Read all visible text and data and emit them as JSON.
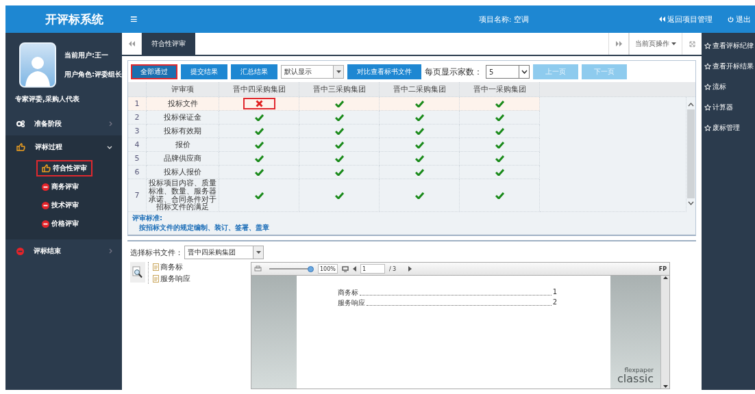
{
  "header": {
    "logo_text": "开评标系统",
    "menu_glyph": "≡",
    "project": "项目名称: 空调",
    "back_link": "返回项目管理",
    "logout": "退出"
  },
  "user": {
    "current": "当前用户:王一",
    "role": "用户角色:评委组长",
    "group": "专家评委,采购人代表"
  },
  "nav": [
    {
      "label": "准备阶段",
      "kind": "gear",
      "expanded": false
    },
    {
      "label": "评标过程",
      "kind": "hand",
      "expanded": true,
      "children": [
        {
          "label": "符合性评审",
          "selected": true
        },
        {
          "label": "商务评审",
          "selected": false
        },
        {
          "label": "技术评审",
          "selected": false
        },
        {
          "label": "价格评审",
          "selected": false
        }
      ]
    },
    {
      "label": "评标结束",
      "kind": "stop",
      "expanded": false
    }
  ],
  "tabs": [
    {
      "label": "符合性评审",
      "selected": true
    }
  ],
  "page_ops": "当前页操作",
  "toolbar": {
    "actions": [
      {
        "label": "全部通过",
        "marked": true
      },
      {
        "label": "提交结果",
        "marked": false
      },
      {
        "label": "汇总结果",
        "marked": false
      }
    ],
    "display_select": "默认显示",
    "compare_button": "对比查看标书文件",
    "per_page_label": "每页显示家数：",
    "per_page": "5",
    "pager": [
      {
        "label": "上一页",
        "disabled": true
      },
      {
        "label": "下一页",
        "disabled": true
      }
    ]
  },
  "table": {
    "columns": [
      "评审项",
      "晋中四采购集团",
      "晋中三采购集团",
      "晋中二采购集团",
      "晋中一采购集团"
    ],
    "rows": [
      {
        "index": "1",
        "item": "投标文件",
        "selected": true,
        "results": [
          {
            "pass": false,
            "marked": true
          },
          {
            "pass": true,
            "marked": false
          },
          {
            "pass": true,
            "marked": false
          },
          {
            "pass": true,
            "marked": false
          }
        ]
      },
      {
        "index": "2",
        "item": "投标保证金",
        "selected": false,
        "results": [
          {
            "pass": true,
            "marked": false
          },
          {
            "pass": true,
            "marked": false
          },
          {
            "pass": true,
            "marked": false
          },
          {
            "pass": true,
            "marked": false
          }
        ]
      },
      {
        "index": "3",
        "item": "投标有效期",
        "selected": false,
        "results": [
          {
            "pass": true,
            "marked": false
          },
          {
            "pass": true,
            "marked": false
          },
          {
            "pass": true,
            "marked": false
          },
          {
            "pass": true,
            "marked": false
          }
        ]
      },
      {
        "index": "4",
        "item": "报价",
        "selected": false,
        "results": [
          {
            "pass": true,
            "marked": false
          },
          {
            "pass": true,
            "marked": false
          },
          {
            "pass": true,
            "marked": false
          },
          {
            "pass": true,
            "marked": false
          }
        ]
      },
      {
        "index": "5",
        "item": "品牌供应商",
        "selected": false,
        "results": [
          {
            "pass": true,
            "marked": false
          },
          {
            "pass": true,
            "marked": false
          },
          {
            "pass": true,
            "marked": false
          },
          {
            "pass": true,
            "marked": false
          }
        ]
      },
      {
        "index": "6",
        "item": "投标人报价",
        "selected": false,
        "results": [
          {
            "pass": true,
            "marked": false
          },
          {
            "pass": true,
            "marked": false
          },
          {
            "pass": true,
            "marked": false
          },
          {
            "pass": true,
            "marked": false
          }
        ]
      },
      {
        "index": "7",
        "item": "投标项目内容、质量标准、数量、服务器承诺、合同条件对于招标文件的满足",
        "selected": false,
        "results": [
          {
            "pass": true,
            "marked": false
          },
          {
            "pass": true,
            "marked": false
          },
          {
            "pass": true,
            "marked": false
          },
          {
            "pass": true,
            "marked": false
          }
        ]
      }
    ]
  },
  "criteria": {
    "title": "评审标准:",
    "text": "按招标文件的规定编制、装订、签署、盖章"
  },
  "files": {
    "label": "选择标书文件：",
    "selected_file": "晋中四采购集团",
    "tree": [
      {
        "label": "商务标"
      },
      {
        "label": "服务响应"
      }
    ]
  },
  "viewer": {
    "zoom": {
      "level": 1
    },
    "zoom_text": "100%",
    "page": "1",
    "total": "/ 3",
    "brand": "FP",
    "toc": [
      {
        "title": "商务标",
        "page": "1"
      },
      {
        "title": "服务响应",
        "page": "2"
      }
    ],
    "logo_small": "flexpaper",
    "logo": "classic"
  },
  "right_panel": [
    {
      "label": "查看评标纪律"
    },
    {
      "label": "查看开标结果"
    },
    {
      "label": "流标"
    },
    {
      "label": "计算器"
    },
    {
      "label": "废标管理"
    }
  ]
}
